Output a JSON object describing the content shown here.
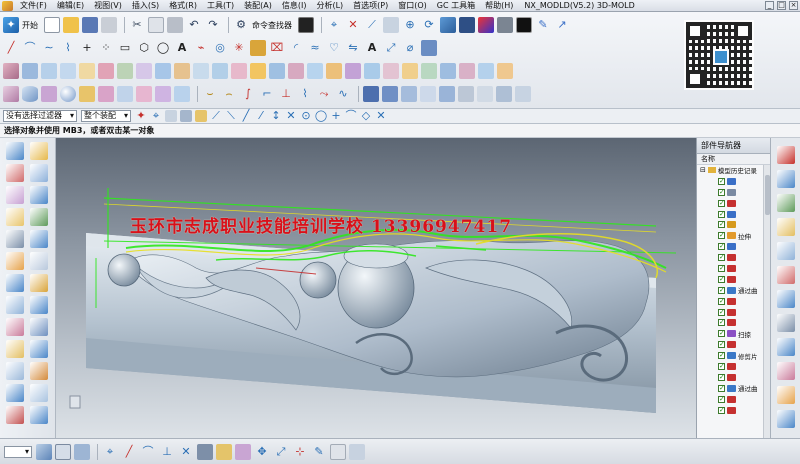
{
  "menu": {
    "items": [
      "文件(F)",
      "编辑(E)",
      "视图(V)",
      "插入(S)",
      "格式(R)",
      "工具(T)",
      "装配(A)",
      "信息(I)",
      "分析(L)",
      "首选项(P)",
      "窗口(O)",
      "GC 工具箱",
      "帮助(H)"
    ],
    "title": "NX_MODLD(V5.2)  3D-MOLD"
  },
  "toolbar": {
    "start_label": "开始",
    "command_finder_label": "命令查找器"
  },
  "selection": {
    "filter_value": "没有选择过滤器",
    "scope_value": "整个装配"
  },
  "cue_line": "选择对象并使用 MB3，或者双击某一对象",
  "viewport": {
    "watermark": "玉环市志成职业技能培训学校 13396947417"
  },
  "navigator": {
    "title": "部件导航器",
    "column_name": "名称",
    "root_label": "模型历史记录",
    "features": [
      {
        "label": "",
        "color": "#3a6fc7"
      },
      {
        "label": "",
        "color": "#7a8aa2"
      },
      {
        "label": "",
        "color": "#c53030"
      },
      {
        "label": "",
        "color": "#3a6fc7"
      },
      {
        "label": "",
        "color": "#d69a1e"
      },
      {
        "label": "拉伸",
        "color": "#e29a2c"
      },
      {
        "label": "",
        "color": "#3a6fc7"
      },
      {
        "label": "",
        "color": "#c53030"
      },
      {
        "label": "",
        "color": "#c53030"
      },
      {
        "label": "",
        "color": "#c53030"
      },
      {
        "label": "通过曲",
        "color": "#3a78c7"
      },
      {
        "label": "",
        "color": "#c53030"
      },
      {
        "label": "",
        "color": "#c53030"
      },
      {
        "label": "",
        "color": "#c53030"
      },
      {
        "label": "扫掠",
        "color": "#8a4fc4"
      },
      {
        "label": "",
        "color": "#c53030"
      },
      {
        "label": "修剪片",
        "color": "#3a78c7"
      },
      {
        "label": "",
        "color": "#c53030"
      },
      {
        "label": "",
        "color": "#c53030"
      },
      {
        "label": "通过曲",
        "color": "#3a78c7"
      },
      {
        "label": "",
        "color": "#c53030"
      },
      {
        "label": "",
        "color": "#c53030"
      }
    ]
  },
  "colors": {
    "watermark": "#d8101a",
    "ornament": "#c9d4de",
    "toolpath_green": "#2ee81c",
    "toolpath_yellow": "#e8e020"
  }
}
